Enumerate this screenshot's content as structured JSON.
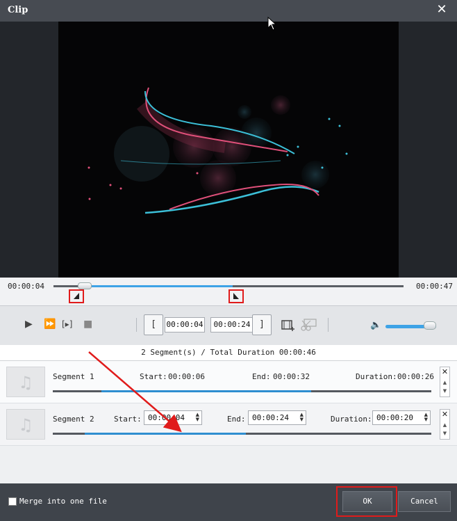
{
  "window": {
    "title": "Clip",
    "close_glyph": "✕"
  },
  "timeline": {
    "current_time": "00:00:04",
    "end_time": "00:00:47"
  },
  "controls": {
    "start_time": "00:00:04",
    "end_time": "00:00:24",
    "start_bracket": "[",
    "end_bracket": "]"
  },
  "summary": "2 Segment(s) / Total Duration 00:00:46",
  "segments": [
    {
      "name": "Segment 1",
      "start_label": "Start:",
      "start": "00:00:06",
      "end_label": "End:",
      "end": "00:00:32",
      "duration_label": "Duration:",
      "duration": "00:00:26"
    },
    {
      "name": "Segment 2",
      "start_label": "Start:",
      "start": "00:00:04",
      "end_label": "End:",
      "end": "00:00:24",
      "duration_label": "Duration:",
      "duration": "00:00:20"
    }
  ],
  "footer": {
    "merge_label": "Merge into one file",
    "ok_label": "OK",
    "cancel_label": "Cancel"
  },
  "colors": {
    "accent": "#3ea3e6",
    "highlight": "#e01b1b"
  },
  "icons": [
    "play-icon",
    "fast-forward-icon",
    "next-frame-icon",
    "stop-icon",
    "add-segment-icon",
    "scissors-icon",
    "volume-icon",
    "music-note-icon"
  ]
}
